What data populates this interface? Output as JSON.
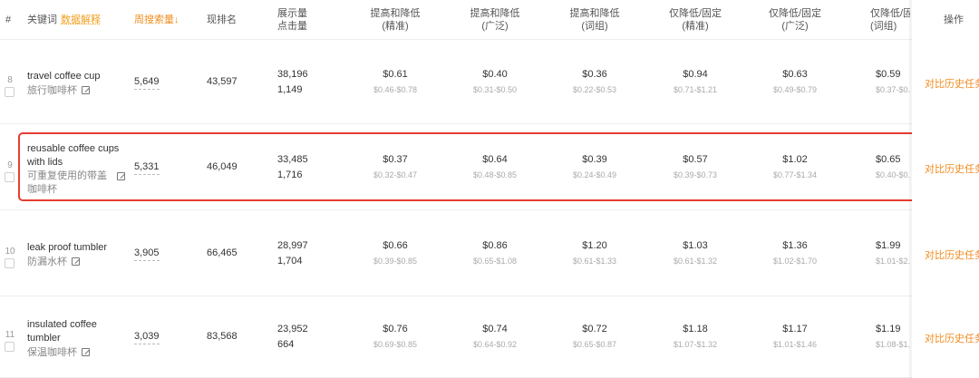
{
  "header": {
    "index": "#",
    "keyword": "关键词",
    "keyword_link": "数据解释",
    "weekly_volume": "周搜索量",
    "current_rank": "现排名",
    "impressions": "展示量",
    "clicks": "点击量",
    "bid_cols": [
      {
        "l1": "提高和降低",
        "l2": "(精准)"
      },
      {
        "l1": "提高和降低",
        "l2": "(广泛)"
      },
      {
        "l1": "提高和降低",
        "l2": "(词组)"
      },
      {
        "l1": "仅降低/固定",
        "l2": "(精准)"
      },
      {
        "l1": "仅降低/固定",
        "l2": "(广泛)"
      },
      {
        "l1": "仅降低/固定",
        "l2": "(词组)"
      }
    ],
    "operation": "操作"
  },
  "rows": [
    {
      "index": "8",
      "keyword_en": "travel coffee cup",
      "keyword_cn": "旅行咖啡杯",
      "volume": "5,649",
      "rank": "43,597",
      "impressions": "38,196",
      "clicks": "1,149",
      "bids": [
        {
          "v": "$0.61",
          "r": "$0.46-$0.78"
        },
        {
          "v": "$0.40",
          "r": "$0.31-$0.50"
        },
        {
          "v": "$0.36",
          "r": "$0.22-$0.53"
        },
        {
          "v": "$0.94",
          "r": "$0.71-$1.21"
        },
        {
          "v": "$0.63",
          "r": "$0.49-$0.79"
        },
        {
          "v": "$0.59",
          "r": "$0.37-$0.8"
        }
      ],
      "op": "对比历史任务"
    },
    {
      "index": "9",
      "keyword_en": "reusable coffee cups with lids",
      "keyword_cn": "可重复使用的带盖咖啡杯",
      "volume": "5,331",
      "rank": "46,049",
      "impressions": "33,485",
      "clicks": "1,716",
      "bids": [
        {
          "v": "$0.37",
          "r": "$0.32-$0.47"
        },
        {
          "v": "$0.64",
          "r": "$0.48-$0.85"
        },
        {
          "v": "$0.39",
          "r": "$0.24-$0.49"
        },
        {
          "v": "$0.57",
          "r": "$0.39-$0.73"
        },
        {
          "v": "$1.02",
          "r": "$0.77-$1.34"
        },
        {
          "v": "$0.65",
          "r": "$0.40-$0."
        }
      ],
      "op": "对比历史任务"
    },
    {
      "index": "10",
      "keyword_en": "leak proof tumbler",
      "keyword_cn": "防漏水杯",
      "volume": "3,905",
      "rank": "66,465",
      "impressions": "28,997",
      "clicks": "1,704",
      "bids": [
        {
          "v": "$0.66",
          "r": "$0.39-$0.85"
        },
        {
          "v": "$0.86",
          "r": "$0.65-$1.08"
        },
        {
          "v": "$1.20",
          "r": "$0.61-$1.33"
        },
        {
          "v": "$1.03",
          "r": "$0.61-$1.32"
        },
        {
          "v": "$1.36",
          "r": "$1.02-$1.70"
        },
        {
          "v": "$1.99",
          "r": "$1.01-$2.5"
        }
      ],
      "op": "对比历史任务"
    },
    {
      "index": "11",
      "keyword_en": "insulated coffee tumbler",
      "keyword_cn": "保温咖啡杯",
      "volume": "3,039",
      "rank": "83,568",
      "impressions": "23,952",
      "clicks": "664",
      "bids": [
        {
          "v": "$0.76",
          "r": "$0.69-$0.85"
        },
        {
          "v": "$0.74",
          "r": "$0.64-$0.92"
        },
        {
          "v": "$0.72",
          "r": "$0.65-$0.87"
        },
        {
          "v": "$1.18",
          "r": "$1.07-$1.32"
        },
        {
          "v": "$1.17",
          "r": "$1.01-$1.46"
        },
        {
          "v": "$1.19",
          "r": "$1.08-$1.3"
        }
      ],
      "op": "对比历史任务"
    }
  ],
  "colors": {
    "accent": "#f08c1e",
    "highlight_border": "#e53d30"
  }
}
